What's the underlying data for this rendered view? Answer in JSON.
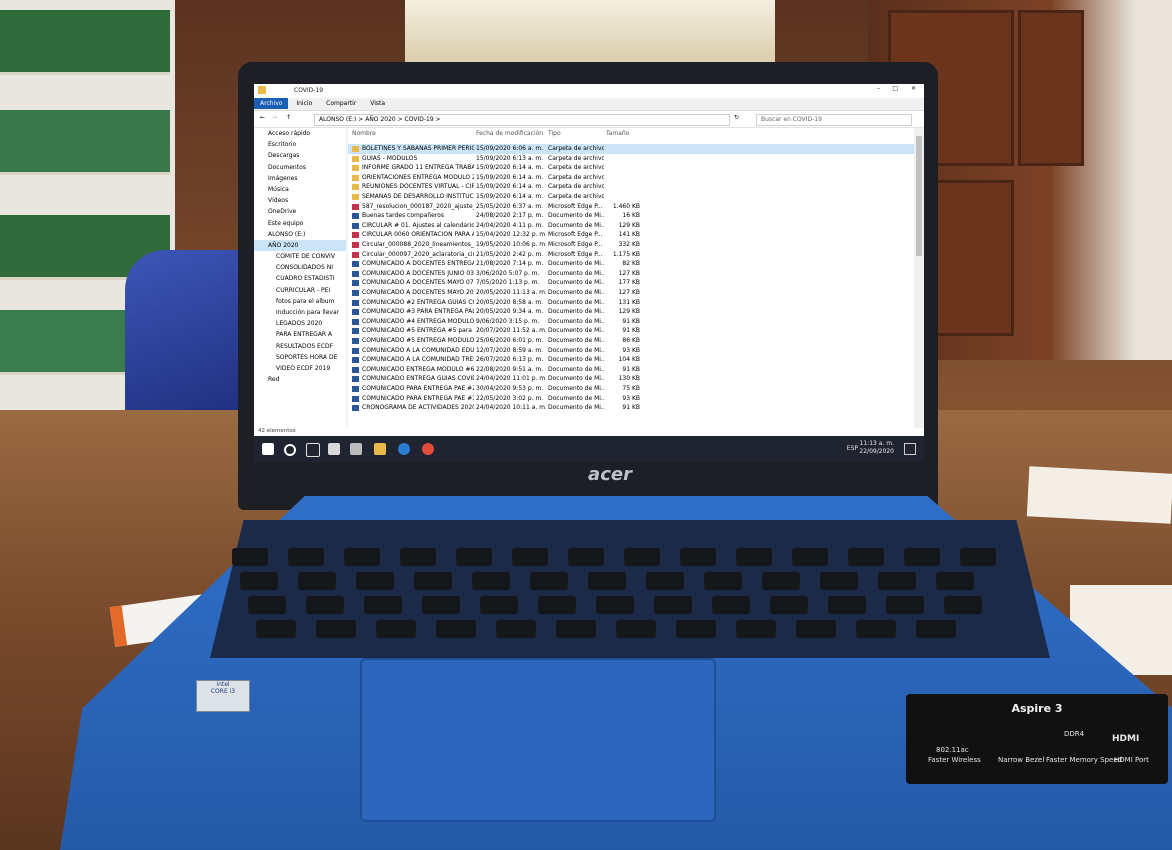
{
  "window": {
    "title": "COVID-19",
    "tabs": [
      "Archivo",
      "Inicio",
      "Compartir",
      "Vista"
    ],
    "path": "ALONSO (E:)  >  AÑO 2020  >  COVID-19  >",
    "search_placeholder": "Buscar en COVID-19"
  },
  "columns": [
    "Nombre",
    "Fecha de modificación",
    "Tipo",
    "Tamaño"
  ],
  "sidebar": {
    "items": [
      "Acceso rápido",
      "Escritorio",
      "Descargas",
      "Documentos",
      "Imágenes",
      "Música",
      "Vídeos",
      "OneDrive",
      "Este equipo",
      "ALONSO (E:)",
      "AÑO 2020",
      "COMITE DE CONVIV",
      "CONSOLIDADOS NI",
      "CUADRO ESTADISTI",
      "CURRICULAR - PEI",
      "fotos para el album",
      "Inducción para llevar",
      "LEGADOS 2020",
      "PARA ENTREGAR A",
      "RESULTADOS ECDF",
      "SOPORTES HORA DE",
      "VIDEO ECDF 2019",
      "Red"
    ]
  },
  "files": [
    {
      "name": "BOLETINES Y SABANAS PRIMER PERIOD...",
      "date": "15/09/2020 6:06 a. m.",
      "type": "Carpeta de archivos",
      "size": "",
      "kind": "folder"
    },
    {
      "name": "GUIAS - MODULOS",
      "date": "15/09/2020 6:13 a. m.",
      "type": "Carpeta de archivos",
      "size": "",
      "kind": "folder"
    },
    {
      "name": "INFORME GRADO 11 ENTREGA TRABAJOS...",
      "date": "15/09/2020 6:14 a. m.",
      "type": "Carpeta de archivos",
      "size": "",
      "kind": "folder"
    },
    {
      "name": "ORIENTACIONES ENTREGA MODULO 2...",
      "date": "15/09/2020 6:14 a. m.",
      "type": "Carpeta de archivos",
      "size": "",
      "kind": "folder"
    },
    {
      "name": "REUNIONES DOCENTES VIRTUAL - CIRCU...",
      "date": "15/09/2020 6:14 a. m.",
      "type": "Carpeta de archivos",
      "size": "",
      "kind": "folder"
    },
    {
      "name": "SEMANAS DE DESARROLLO INSTITUCIO...",
      "date": "15/09/2020 6:14 a. m.",
      "type": "Carpeta de archivos",
      "size": "",
      "kind": "folder"
    },
    {
      "name": "587_resolucion_000187_2020_ajuste_calen...",
      "date": "25/05/2020 6:37 a. m.",
      "type": "Microsoft Edge P...",
      "size": "1.460 KB",
      "kind": "pdf"
    },
    {
      "name": "Buenas tardes compañeros",
      "date": "24/08/2020 2:17 p. m.",
      "type": "Documento de Mi...",
      "size": "16 KB",
      "kind": "doc"
    },
    {
      "name": "CIRCULAR # 01. Ajustes al calendario aca...",
      "date": "24/04/2020 4:11 p. m.",
      "type": "Documento de Mi...",
      "size": "129 KB",
      "kind": "doc"
    },
    {
      "name": "CIRCULAR 0060 ORIENTACION PARA AP...",
      "date": "15/04/2020 12:32 p. m.",
      "type": "Microsoft Edge P...",
      "size": "141 KB",
      "kind": "pdf"
    },
    {
      "name": "Circular_000088_2020_lineamientos_educ...",
      "date": "19/05/2020 10:06 p. m.",
      "type": "Microsoft Edge P...",
      "size": "332 KB",
      "kind": "pdf"
    },
    {
      "name": "Circular_000097_2020_aclaratoria_circular...",
      "date": "21/05/2020 2:42 p. m.",
      "type": "Microsoft Edge P...",
      "size": "1.175 KB",
      "kind": "pdf"
    },
    {
      "name": "COMUNICADO A DOCENTES ENTREGA ...",
      "date": "21/08/2020 7:14 p. m.",
      "type": "Documento de Mi...",
      "size": "82 KB",
      "kind": "doc"
    },
    {
      "name": "COMUNICADO A DOCENTES JUNIO 03",
      "date": "3/06/2020 5:07 p. m.",
      "type": "Documento de Mi...",
      "size": "127 KB",
      "kind": "doc"
    },
    {
      "name": "COMUNICADO A DOCENTES MAYO 07",
      "date": "7/05/2020 1:13 p. m.",
      "type": "Documento de Mi...",
      "size": "177 KB",
      "kind": "doc"
    },
    {
      "name": "COMUNICADO A DOCENTES MAYO 20 F...",
      "date": "20/05/2020 11:13 a. m.",
      "type": "Documento de Mi...",
      "size": "127 KB",
      "kind": "doc"
    },
    {
      "name": "COMUNICADO #2 ENTREGA GUIAS COVI...",
      "date": "20/05/2020 8:58 a. m.",
      "type": "Documento de Mi...",
      "size": "131 KB",
      "kind": "doc"
    },
    {
      "name": "COMUNICADO #3 PARA ENTREGA PAL...",
      "date": "20/05/2020 9:34 a. m.",
      "type": "Documento de Mi...",
      "size": "129 KB",
      "kind": "doc"
    },
    {
      "name": "COMUNICADO #4 ENTREGA MODULO P...",
      "date": "9/06/2020 3:15 p. m.",
      "type": "Documento de Mi...",
      "size": "91 KB",
      "kind": "doc"
    },
    {
      "name": "COMUNICADO #5 ENTREGA #5 para las...",
      "date": "20/07/2020 11:52 a. m.",
      "type": "Documento de Mi...",
      "size": "91 KB",
      "kind": "doc"
    },
    {
      "name": "COMUNICADO #5 ENTREGA MODULO #...",
      "date": "25/06/2020 6:01 p. m.",
      "type": "Documento de Mi...",
      "size": "86 KB",
      "kind": "doc"
    },
    {
      "name": "COMUNICADO A LA COMUNIDAD EDUC...",
      "date": "12/07/2020 8:59 a. m.",
      "type": "Documento de Mi...",
      "size": "93 KB",
      "kind": "doc"
    },
    {
      "name": "COMUNICADO A LA COMUNIDAD TREM...",
      "date": "26/07/2020 6:13 p. m.",
      "type": "Documento de Mi...",
      "size": "104 KB",
      "kind": "word"
    },
    {
      "name": "COMUNICADO ENTREGA MODULO #6 p...",
      "date": "22/08/2020 9:51 a. m.",
      "type": "Documento de Mi...",
      "size": "91 KB",
      "kind": "doc"
    },
    {
      "name": "COMUNICADO ENTREGA GUIAS COVID-19",
      "date": "24/04/2020 11:01 p. m.",
      "type": "Documento de Mi...",
      "size": "130 KB",
      "kind": "doc"
    },
    {
      "name": "COMUNICADO PARA ENTREGA PAE #2 ...",
      "date": "30/04/2020 9:53 p. m.",
      "type": "Documento de Mi...",
      "size": "75 KB",
      "kind": "doc"
    },
    {
      "name": "COMUNICADO PARA ENTREGA PAE #3 A...",
      "date": "22/05/2020 3:02 p. m.",
      "type": "Documento de Mi...",
      "size": "93 KB",
      "kind": "doc"
    },
    {
      "name": "CRONOGRAMA DE ACTIVIDADES 2020 X...",
      "date": "24/04/2020 10:11 a. m.",
      "type": "Documento de Mi...",
      "size": "91 KB",
      "kind": "doc"
    }
  ],
  "status": {
    "items_count": "42 elementos"
  },
  "taskbar": {
    "lang": "ESP",
    "time": "11:13 a. m.",
    "date": "22/09/2020"
  },
  "laptop": {
    "brand": "acer",
    "model": "Aspire 3",
    "sticker_labels": [
      "802.11ac",
      "Faster Wireless",
      "Narrow Bezel",
      "DDR4",
      "Faster Memory Speed",
      "HDMI",
      "HDMI Port"
    ]
  },
  "colors": {
    "folder": "#e8b84a",
    "doc": "#2b579a",
    "pdf": "#c4314b",
    "selection": "#cce4f7",
    "laptop_blue": "#2a63b6"
  }
}
